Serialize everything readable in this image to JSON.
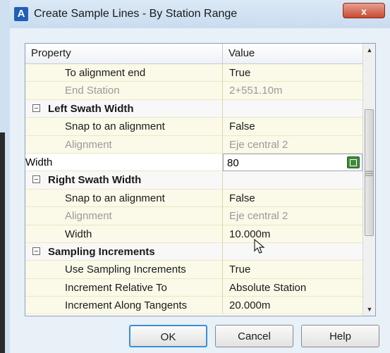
{
  "window": {
    "title": "Create Sample Lines - By Station Range",
    "app_icon": "A",
    "close_label": "x"
  },
  "grid": {
    "col_property": "Property",
    "col_value": "Value",
    "rows": [
      {
        "type": "prop",
        "label": "To alignment end",
        "value": "True",
        "disabled": false
      },
      {
        "type": "prop",
        "label": "End Station",
        "value": "2+551.10m",
        "disabled": true
      },
      {
        "type": "cat",
        "label": "Left Swath Width"
      },
      {
        "type": "prop",
        "label": "Snap to an alignment",
        "value": "False",
        "disabled": false
      },
      {
        "type": "prop",
        "label": "Alignment",
        "value": "Eje central 2",
        "disabled": true
      },
      {
        "type": "edit",
        "label": "Width",
        "value": "80"
      },
      {
        "type": "cat",
        "label": "Right Swath Width"
      },
      {
        "type": "prop",
        "label": "Snap to an alignment",
        "value": "False",
        "disabled": false
      },
      {
        "type": "prop",
        "label": "Alignment",
        "value": "Eje central 2",
        "disabled": true
      },
      {
        "type": "prop",
        "label": "Width",
        "value": "10.000m",
        "disabled": false
      },
      {
        "type": "cat",
        "label": "Sampling Increments"
      },
      {
        "type": "prop",
        "label": "Use Sampling Increments",
        "value": "True",
        "disabled": false
      },
      {
        "type": "prop",
        "label": "Increment Relative To",
        "value": "Absolute Station",
        "disabled": false
      },
      {
        "type": "prop",
        "label": "Increment Along Tangents",
        "value": "20.000m",
        "disabled": false
      }
    ]
  },
  "buttons": {
    "ok": "OK",
    "cancel": "Cancel",
    "help": "Help"
  },
  "icons": {
    "app": "autocad-icon",
    "collapse": "minus-box-icon",
    "pick": "pick-in-drawing-icon",
    "cursor": "mouse-pointer-icon"
  }
}
